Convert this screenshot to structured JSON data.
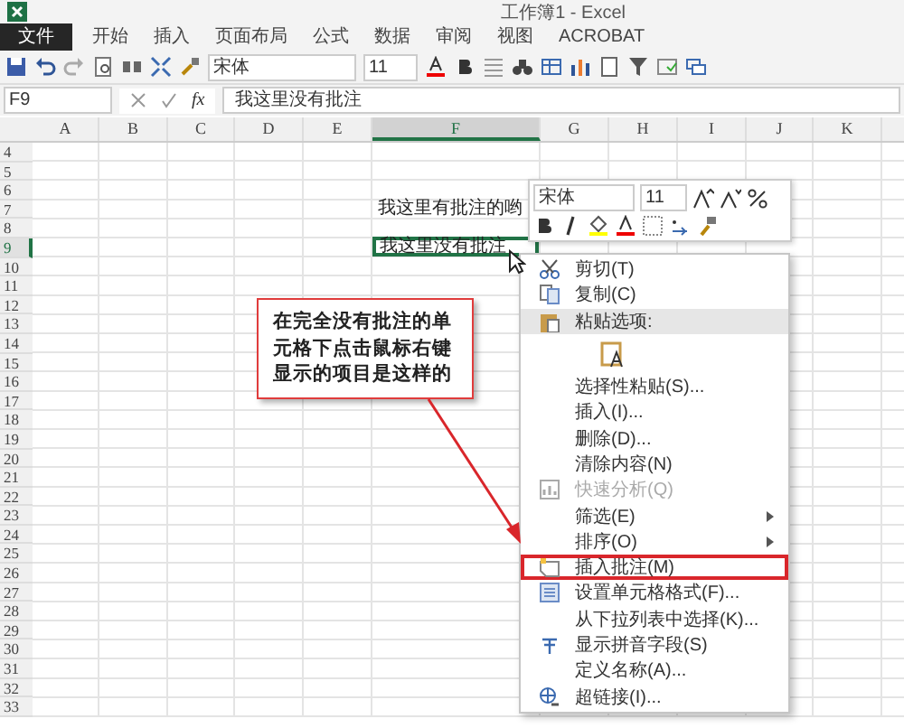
{
  "window": {
    "title": "工作簿1 - Excel"
  },
  "ribbon_tabs": [
    {
      "label": "文件",
      "kind": "file"
    },
    {
      "label": "开始",
      "kind": "tab"
    },
    {
      "label": "插入",
      "kind": "tab"
    },
    {
      "label": "页面布局",
      "kind": "tab"
    },
    {
      "label": "公式",
      "kind": "tab"
    },
    {
      "label": "数据",
      "kind": "tab"
    },
    {
      "label": "审阅",
      "kind": "tab"
    },
    {
      "label": "视图",
      "kind": "tab"
    },
    {
      "label": "ACROBAT",
      "kind": "tab"
    }
  ],
  "quick_access": {
    "font": "宋体",
    "size": "11"
  },
  "formula_bar": {
    "name_box": "F9",
    "fx": "fx",
    "value": "我这里没有批注"
  },
  "columns": [
    {
      "label": "A",
      "selected": false
    },
    {
      "label": "B",
      "selected": false
    },
    {
      "label": "C",
      "selected": false
    },
    {
      "label": "D",
      "selected": false
    },
    {
      "label": "E",
      "selected": false
    },
    {
      "label": "F",
      "selected": true
    },
    {
      "label": "G",
      "selected": false
    },
    {
      "label": "H",
      "selected": false
    },
    {
      "label": "I",
      "selected": false
    },
    {
      "label": "J",
      "selected": false
    },
    {
      "label": "K",
      "selected": false
    }
  ],
  "rows": [
    {
      "label": "4",
      "selected": false
    },
    {
      "label": "5",
      "selected": false
    },
    {
      "label": "6",
      "selected": false
    },
    {
      "label": "7",
      "selected": false,
      "cell": {
        "text": "我这里有批注的哟",
        "active": false
      }
    },
    {
      "label": "8",
      "selected": false
    },
    {
      "label": "9",
      "selected": true,
      "cell": {
        "text": "我这里没有批注",
        "active": true
      }
    },
    {
      "label": "10",
      "selected": false
    },
    {
      "label": "11",
      "selected": false
    },
    {
      "label": "12",
      "selected": false
    },
    {
      "label": "13",
      "selected": false
    },
    {
      "label": "14",
      "selected": false
    },
    {
      "label": "15",
      "selected": false
    },
    {
      "label": "16",
      "selected": false
    },
    {
      "label": "17",
      "selected": false
    },
    {
      "label": "18",
      "selected": false
    },
    {
      "label": "19",
      "selected": false
    },
    {
      "label": "20",
      "selected": false
    },
    {
      "label": "21",
      "selected": false
    },
    {
      "label": "22",
      "selected": false
    },
    {
      "label": "23",
      "selected": false
    },
    {
      "label": "24",
      "selected": false
    },
    {
      "label": "25",
      "selected": false
    },
    {
      "label": "26",
      "selected": false
    },
    {
      "label": "27",
      "selected": false
    },
    {
      "label": "28",
      "selected": false
    },
    {
      "label": "29",
      "selected": false
    },
    {
      "label": "30",
      "selected": false
    },
    {
      "label": "31",
      "selected": false
    },
    {
      "label": "32",
      "selected": false
    },
    {
      "label": "33",
      "selected": false
    }
  ],
  "mini_toolbar": {
    "font": "宋体",
    "size": "11"
  },
  "context_menu": [
    {
      "kind": "cut",
      "label": "剪切(T)",
      "disabled": false,
      "submenu": false,
      "marked": false
    },
    {
      "kind": "copy",
      "label": "复制(C)",
      "disabled": false,
      "submenu": false,
      "marked": false
    },
    {
      "kind": "paste-options",
      "label": "粘贴选项:",
      "disabled": false,
      "submenu": false,
      "marked": false
    },
    {
      "kind": "paste-buttons",
      "disabled": false,
      "submenu": false,
      "marked": false
    },
    {
      "kind": "plain",
      "label": "选择性粘贴(S)...",
      "disabled": false,
      "submenu": false,
      "marked": false
    },
    {
      "kind": "plain",
      "label": "插入(I)...",
      "disabled": false,
      "submenu": false,
      "marked": false
    },
    {
      "kind": "plain",
      "label": "删除(D)...",
      "disabled": false,
      "submenu": false,
      "marked": false
    },
    {
      "kind": "plain",
      "label": "清除内容(N)",
      "disabled": false,
      "submenu": false,
      "marked": false
    },
    {
      "kind": "quick-analysis",
      "label": "快速分析(Q)",
      "disabled": true,
      "submenu": false,
      "marked": false
    },
    {
      "kind": "plain",
      "label": "筛选(E)",
      "disabled": false,
      "submenu": true,
      "marked": false
    },
    {
      "kind": "plain",
      "label": "排序(O)",
      "disabled": false,
      "submenu": true,
      "marked": false
    },
    {
      "kind": "comment",
      "label": "插入批注(M)",
      "disabled": false,
      "submenu": false,
      "marked": true
    },
    {
      "kind": "format",
      "label": "设置单元格格式(F)...",
      "disabled": false,
      "submenu": false,
      "marked": false
    },
    {
      "kind": "plain",
      "label": "从下拉列表中选择(K)...",
      "disabled": false,
      "submenu": false,
      "marked": false
    },
    {
      "kind": "phonetic",
      "label": "显示拼音字段(S)",
      "disabled": false,
      "submenu": false,
      "marked": false
    },
    {
      "kind": "plain",
      "label": "定义名称(A)...",
      "disabled": false,
      "submenu": false,
      "marked": false
    },
    {
      "kind": "link",
      "label": "超链接(I)...",
      "disabled": false,
      "submenu": false,
      "marked": false
    }
  ],
  "callout": {
    "text": "在完全没有批注的单元格下点击鼠标右键显示的项目是这样的"
  }
}
